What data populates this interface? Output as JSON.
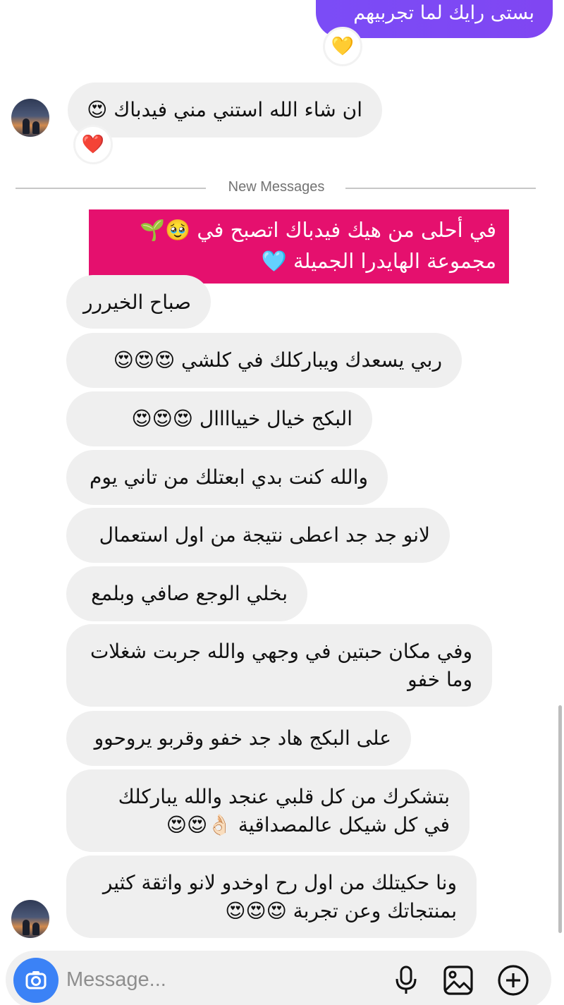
{
  "outgoing": {
    "text": "بستى رايك لما تجربيهم",
    "reaction": "💛"
  },
  "first_incoming": {
    "text": "ان شاء الله استني مني فيدباك 😍",
    "reaction": "❤️"
  },
  "divider": {
    "label": "New Messages"
  },
  "banner": {
    "line1": "في أحلى من هيك فيدباك اتصبح في 🥹🌱",
    "line2": "مجموعة الهايدرا الجميلة",
    "heart": "🩵"
  },
  "messages": [
    "صباح الخيررر",
    "ربي يسعدك ويباركلك في كلشي 😍😍😍",
    "البكج خيال خيياااال 😍😍😍",
    "والله كنت بدي ابعتلك من تاني يوم",
    "لانو جد جد اعطى نتيجة من اول استعمال",
    "بخلي الوجع صافي وبلمع",
    "وفي مكان حبتين في وجهي والله جربت شغلات وما خفو",
    "على البكج هاد جد خفو وقربو يروحوو",
    "بتشكرك من كل قلبي عنجد والله يباركلك في كل شيكل عالمصداقية 👌🏻😍😍",
    "ونا حكيتلك من اول رح اوخدو لانو واثقة كثير بمنتجاتك وعن تجربة 😍😍😍"
  ],
  "composer": {
    "placeholder": "Message...",
    "camera_icon": "camera-icon",
    "mic_icon": "microphone-icon",
    "gallery_icon": "gallery-icon",
    "add_icon": "plus-icon"
  },
  "colors": {
    "outgoing_bubble": "#7b4cf6",
    "incoming_bubble": "#efefef",
    "banner": "#e5106e",
    "camera_button": "#3b82f6"
  }
}
